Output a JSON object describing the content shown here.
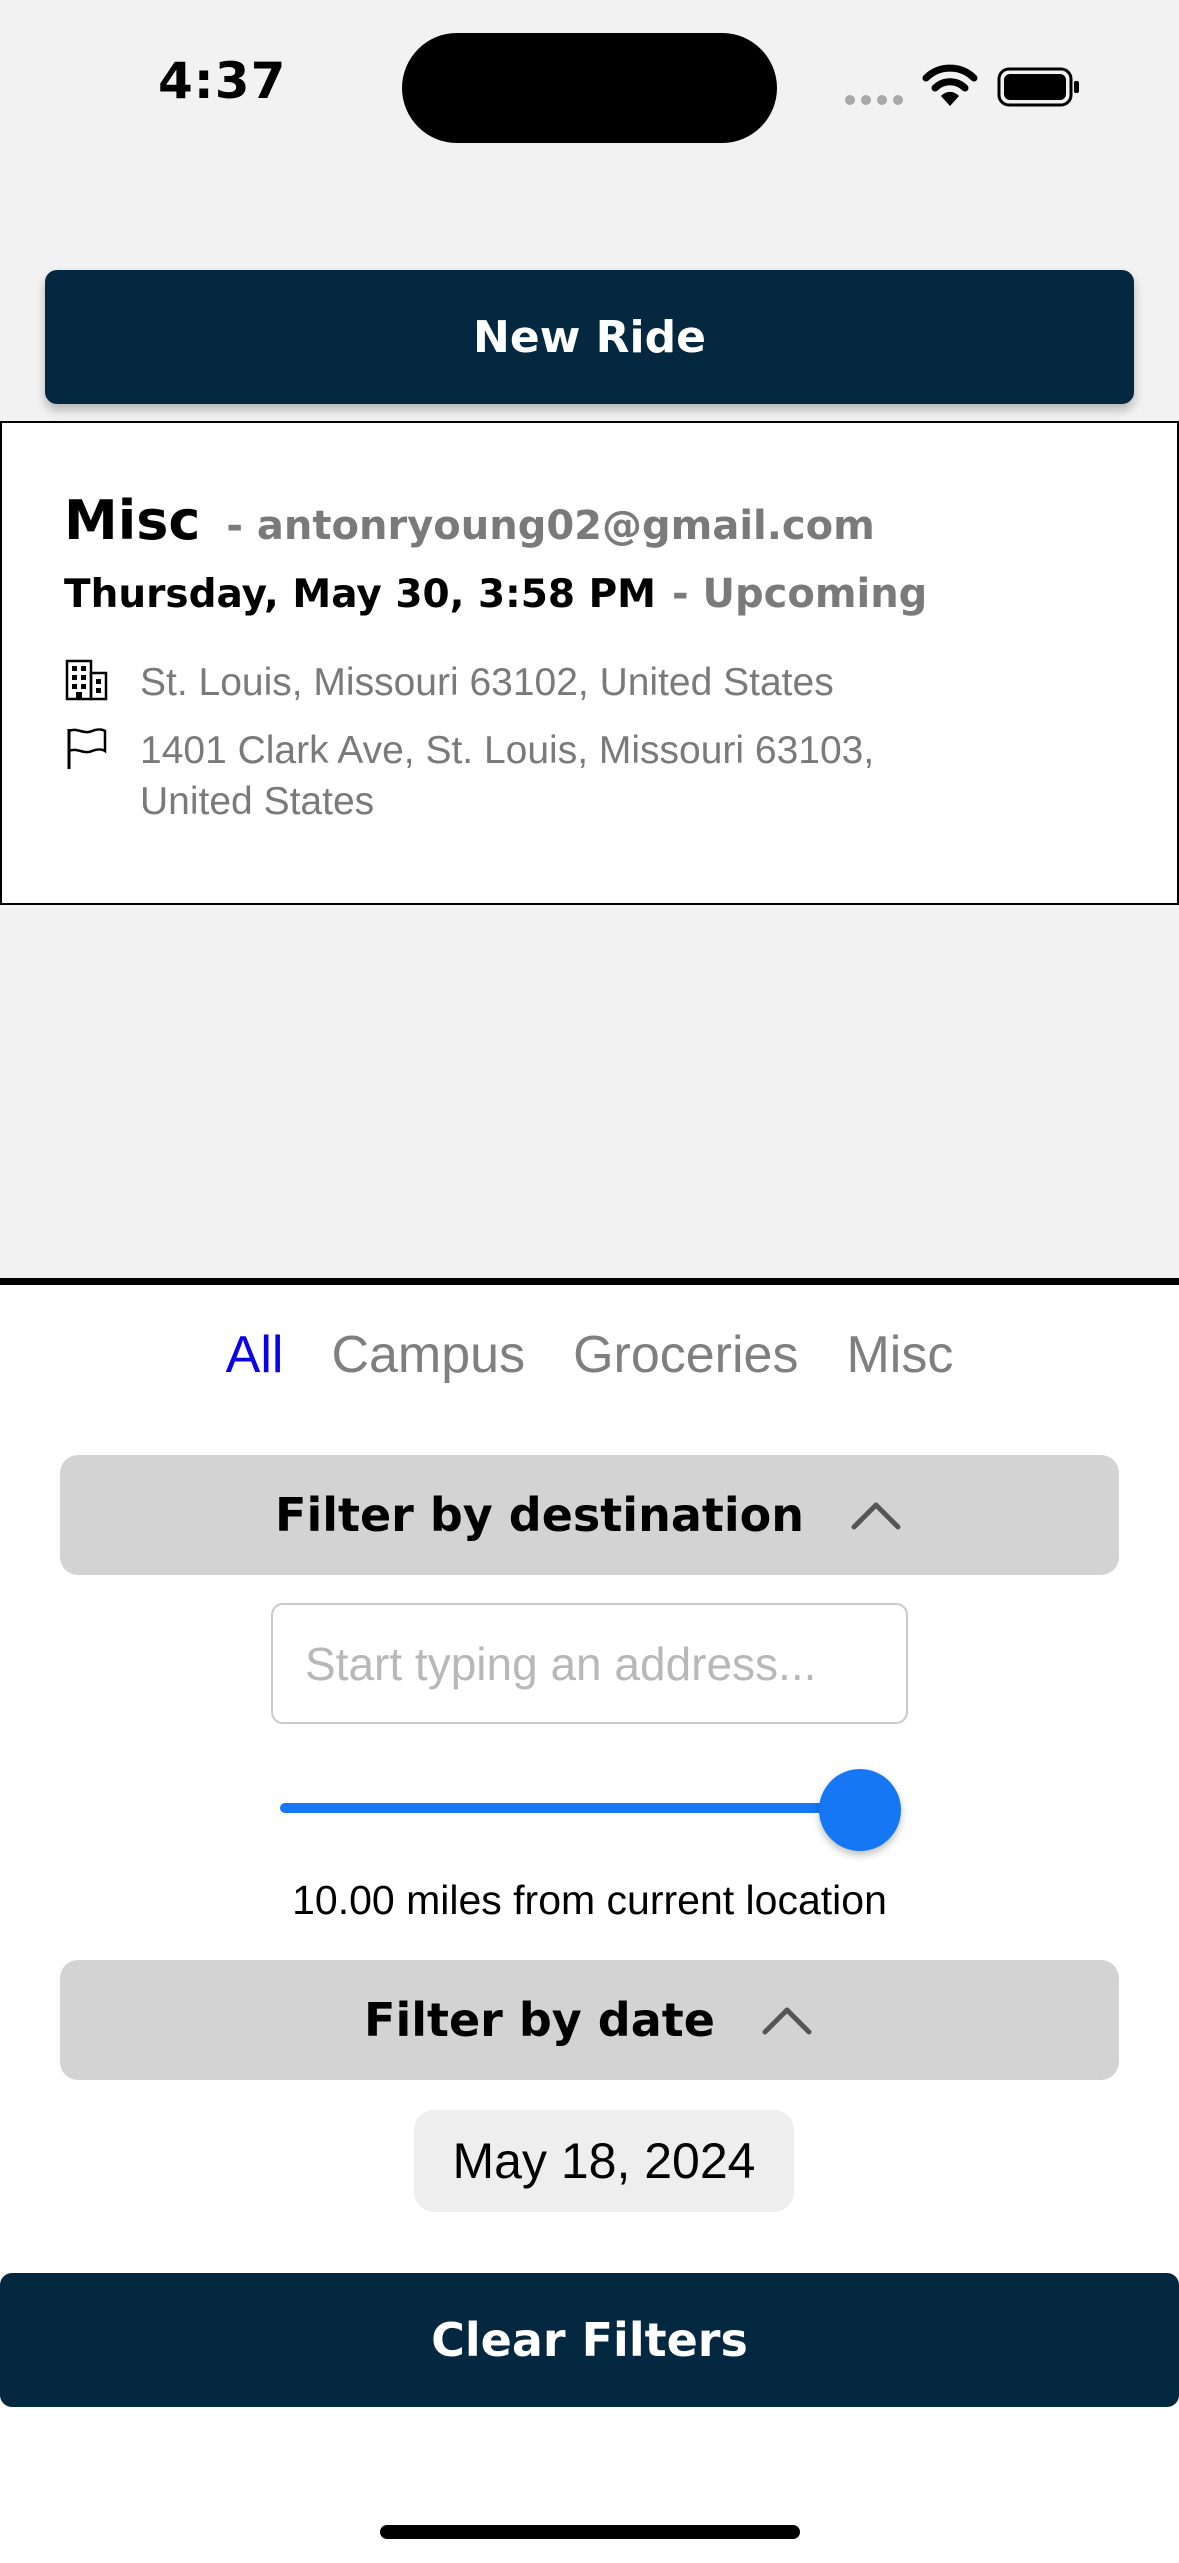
{
  "status_bar": {
    "time": "4:37"
  },
  "new_ride": {
    "label": "New Ride"
  },
  "ride_card": {
    "category": "Misc",
    "email": "- antonryoung02@gmail.com",
    "datetime": "Thursday, May 30, 3:58 PM",
    "status": "- Upcoming",
    "origin_address": "St. Louis, Missouri 63102, United States",
    "destination_address": "1401 Clark Ave, St. Louis, Missouri 63103, United States",
    "origin_icon": "building-icon",
    "destination_icon": "flag-icon"
  },
  "tabs": [
    {
      "label": "All",
      "active": true
    },
    {
      "label": "Campus",
      "active": false
    },
    {
      "label": "Groceries",
      "active": false
    },
    {
      "label": "Misc",
      "active": false
    }
  ],
  "filters": {
    "destination_header": "Filter by destination",
    "address_placeholder": "Start typing an address...",
    "slider_value_fraction": 1.0,
    "distance_label": "10.00 miles from current location",
    "date_header": "Filter by date",
    "date_value": "May 18, 2024",
    "clear_label": "Clear Filters"
  },
  "colors": {
    "primary_dark": "#03283f",
    "accent_blue": "#1677f5",
    "active_tab": "#0a00e6",
    "muted_text": "#7a7a7a"
  }
}
